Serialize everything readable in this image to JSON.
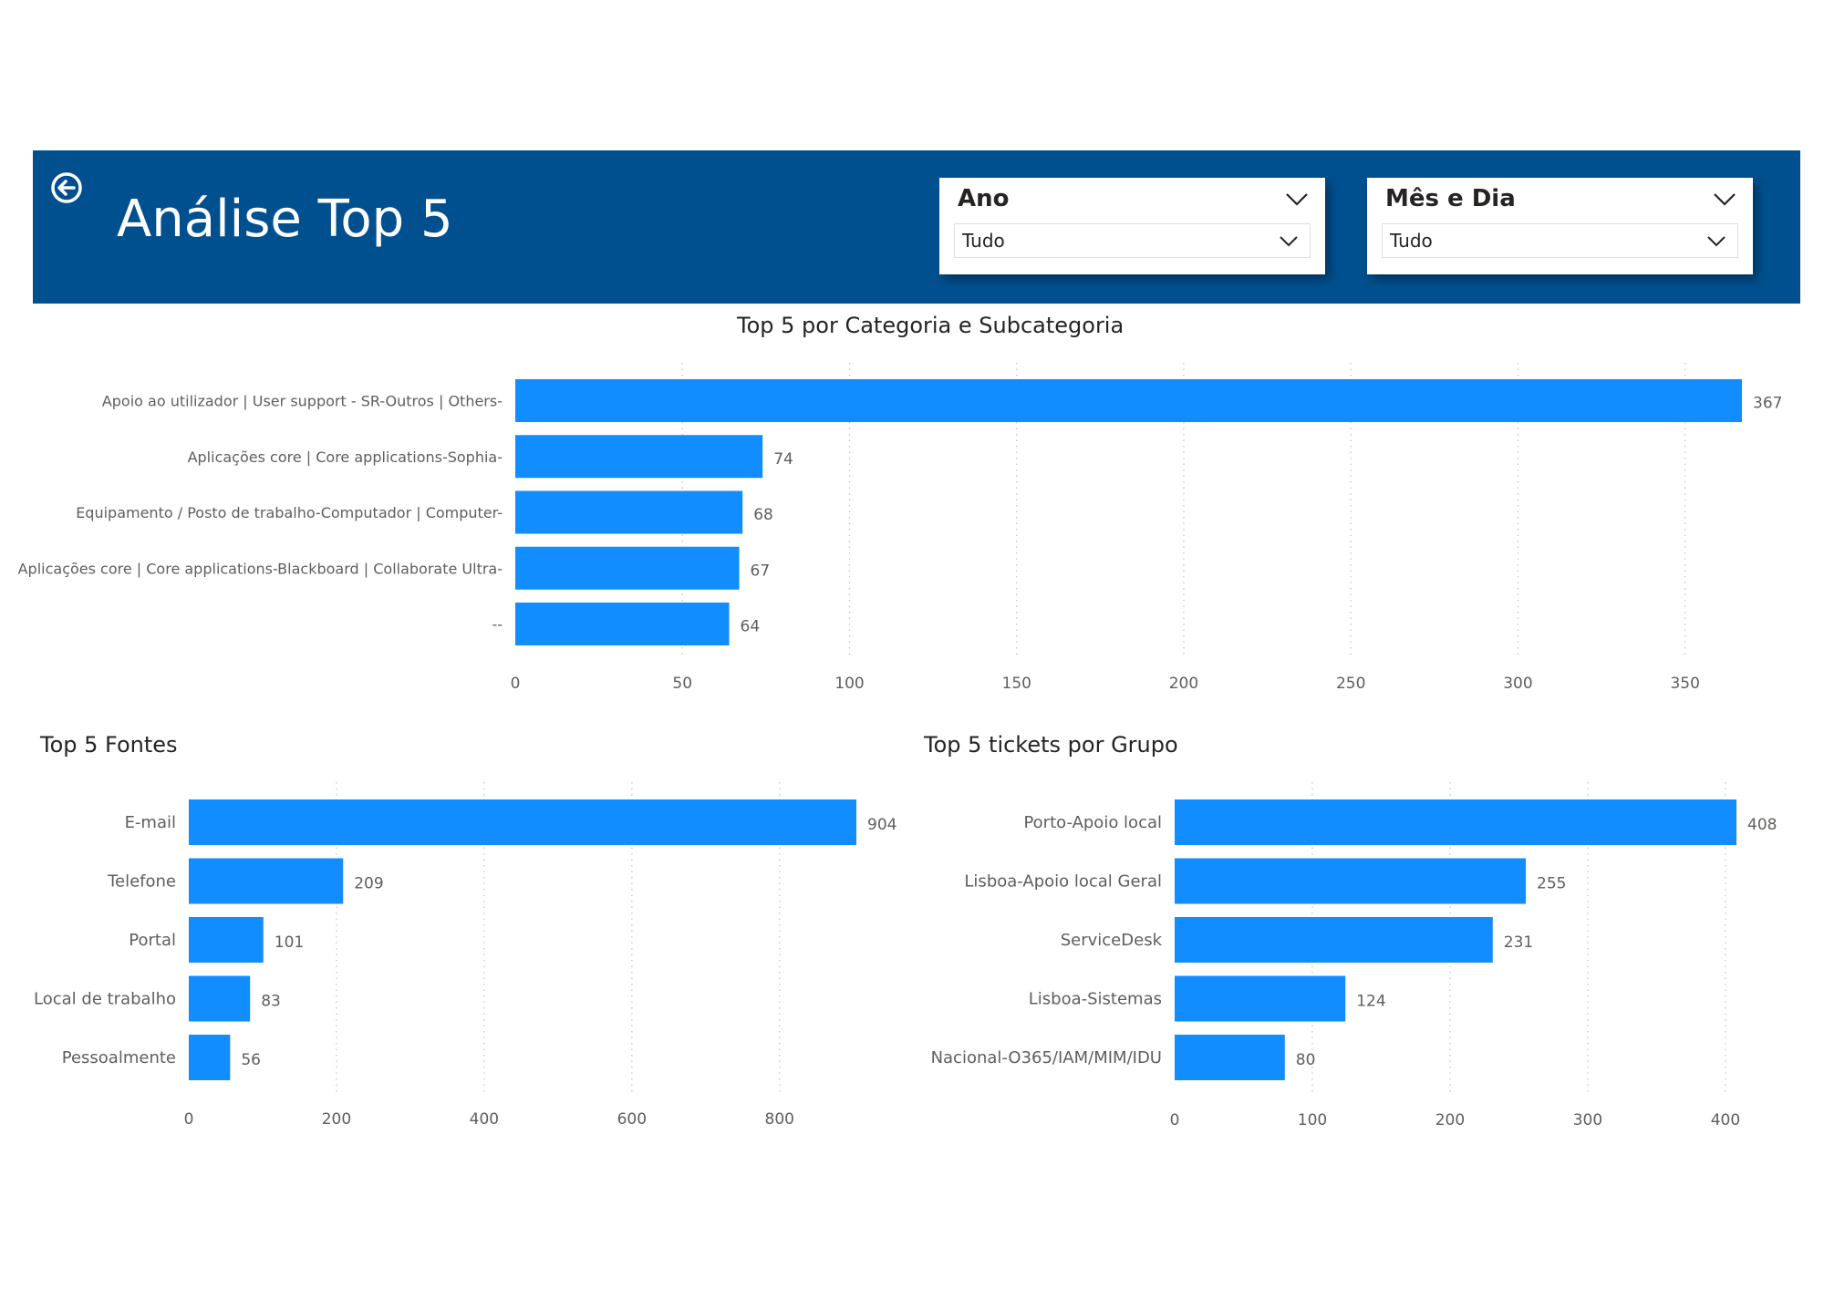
{
  "header": {
    "title": "Análise Top 5",
    "back_icon": "arrow-left-circle-icon",
    "background": "#00508f"
  },
  "slicers": [
    {
      "title": "Ano",
      "value": "Tudo"
    },
    {
      "title": "Mês e Dia",
      "value": "Tudo"
    }
  ],
  "colors": {
    "bar": "#118dff",
    "text": "#605e5c",
    "grid": "#c8c6c4"
  },
  "chart_data": [
    {
      "type": "bar",
      "orientation": "horizontal",
      "title": "Top 5 por Categoria e Subcategoria",
      "categories": [
        "Apoio ao utilizador | User support - SR-Outros | Others-",
        "Aplicações core | Core applications-Sophia-",
        "Equipamento / Posto de trabalho-Computador | Computer-",
        "Aplicações core | Core applications-Blackboard | Collaborate Ultra-",
        "--"
      ],
      "values": [
        367,
        74,
        68,
        67,
        64
      ],
      "xticks": [
        0,
        50,
        100,
        150,
        200,
        250,
        300,
        350
      ],
      "xlim": [
        0,
        367
      ],
      "grid": true,
      "data_labels": true
    },
    {
      "type": "bar",
      "orientation": "horizontal",
      "title": "Top 5 Fontes",
      "categories": [
        "E-mail",
        "Telefone",
        "Portal",
        "Local de trabalho",
        "Pessoalmente"
      ],
      "values": [
        904,
        209,
        101,
        83,
        56
      ],
      "xticks": [
        0,
        200,
        400,
        600,
        800
      ],
      "xlim": [
        0,
        904
      ],
      "grid": true,
      "data_labels": true
    },
    {
      "type": "bar",
      "orientation": "horizontal",
      "title": "Top 5 tickets por Grupo",
      "categories": [
        "Porto-Apoio local",
        "Lisboa-Apoio local Geral",
        "ServiceDesk",
        "Lisboa-Sistemas",
        "Nacional-O365/IAM/MIM/IDU"
      ],
      "values": [
        408,
        255,
        231,
        124,
        80
      ],
      "xticks": [
        0,
        100,
        200,
        300,
        400
      ],
      "xlim": [
        0,
        408
      ],
      "grid": true,
      "data_labels": true
    }
  ]
}
